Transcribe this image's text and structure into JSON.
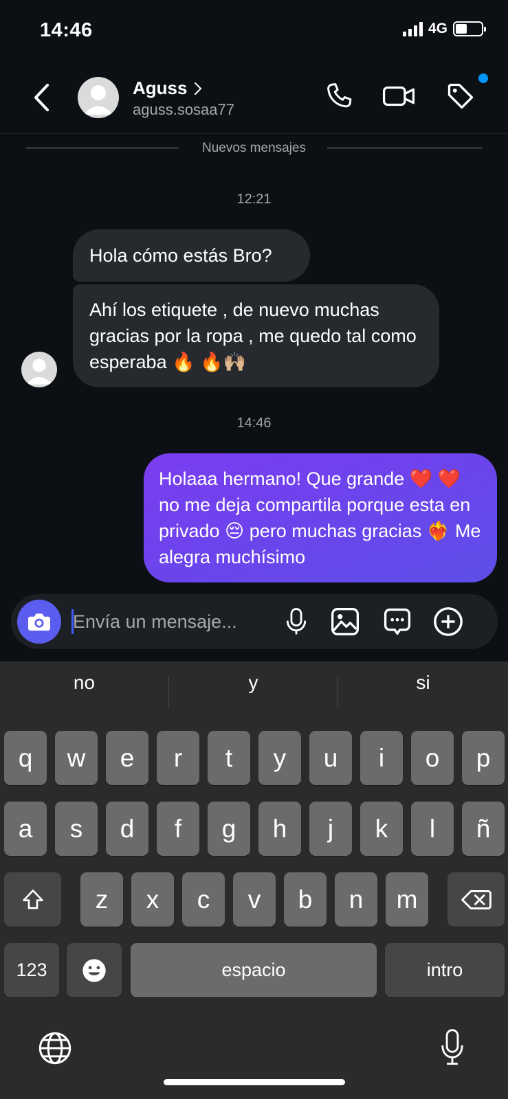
{
  "status_bar": {
    "time": "14:46",
    "network": "4G",
    "signal_bars": 4,
    "battery_level": 0.45
  },
  "header": {
    "contact_name": "Aguss",
    "contact_handle": "aguss.sosaa77",
    "icons": [
      "back-arrow-icon",
      "phone-icon",
      "video-camera-icon",
      "tag-icon"
    ],
    "notification_dot_color": "#0095f6"
  },
  "chat": {
    "new_messages_label": "Nuevos mensajes",
    "timestamp_1": "12:21",
    "incoming": [
      "Hola cómo estás Bro?",
      "Ahí los etiquete , de nuevo muchas gracias por la ropa , me quedo tal como esperaba 🔥 🔥🙌🏼"
    ],
    "timestamp_2": "14:46",
    "outgoing": [
      "Holaaa hermano! Que grande ❤️ ❤️ no me deja compartila porque esta en privado 😔 pero muchas gracias ❤️‍🔥 Me alegra muchísimo"
    ]
  },
  "composer": {
    "placeholder": "Envía un mensaje...",
    "icons": [
      "camera-icon",
      "microphone-icon",
      "image-icon",
      "sticker-chat-icon",
      "plus-icon"
    ]
  },
  "keyboard": {
    "suggestions": [
      "no",
      "y",
      "si"
    ],
    "row1": [
      "q",
      "w",
      "e",
      "r",
      "t",
      "y",
      "u",
      "i",
      "o",
      "p"
    ],
    "row2": [
      "a",
      "s",
      "d",
      "f",
      "g",
      "h",
      "j",
      "k",
      "l",
      "ñ"
    ],
    "row3": [
      "z",
      "x",
      "c",
      "v",
      "b",
      "n",
      "m"
    ],
    "numbers_key": "123",
    "space_key": "espacio",
    "return_key": "intro",
    "icons": [
      "shift-icon",
      "backspace-icon",
      "emoji-icon",
      "globe-icon",
      "dictation-mic-icon"
    ]
  },
  "colors": {
    "background": "#0c1014",
    "incoming_bubble": "#262a2f",
    "outgoing_bubble_start": "#7a3df0",
    "outgoing_bubble_end": "#5d4fe8",
    "camera_button": "#5b5cf0",
    "keyboard_bg": "#2b2b2d",
    "key_bg": "#6b6b6d"
  }
}
